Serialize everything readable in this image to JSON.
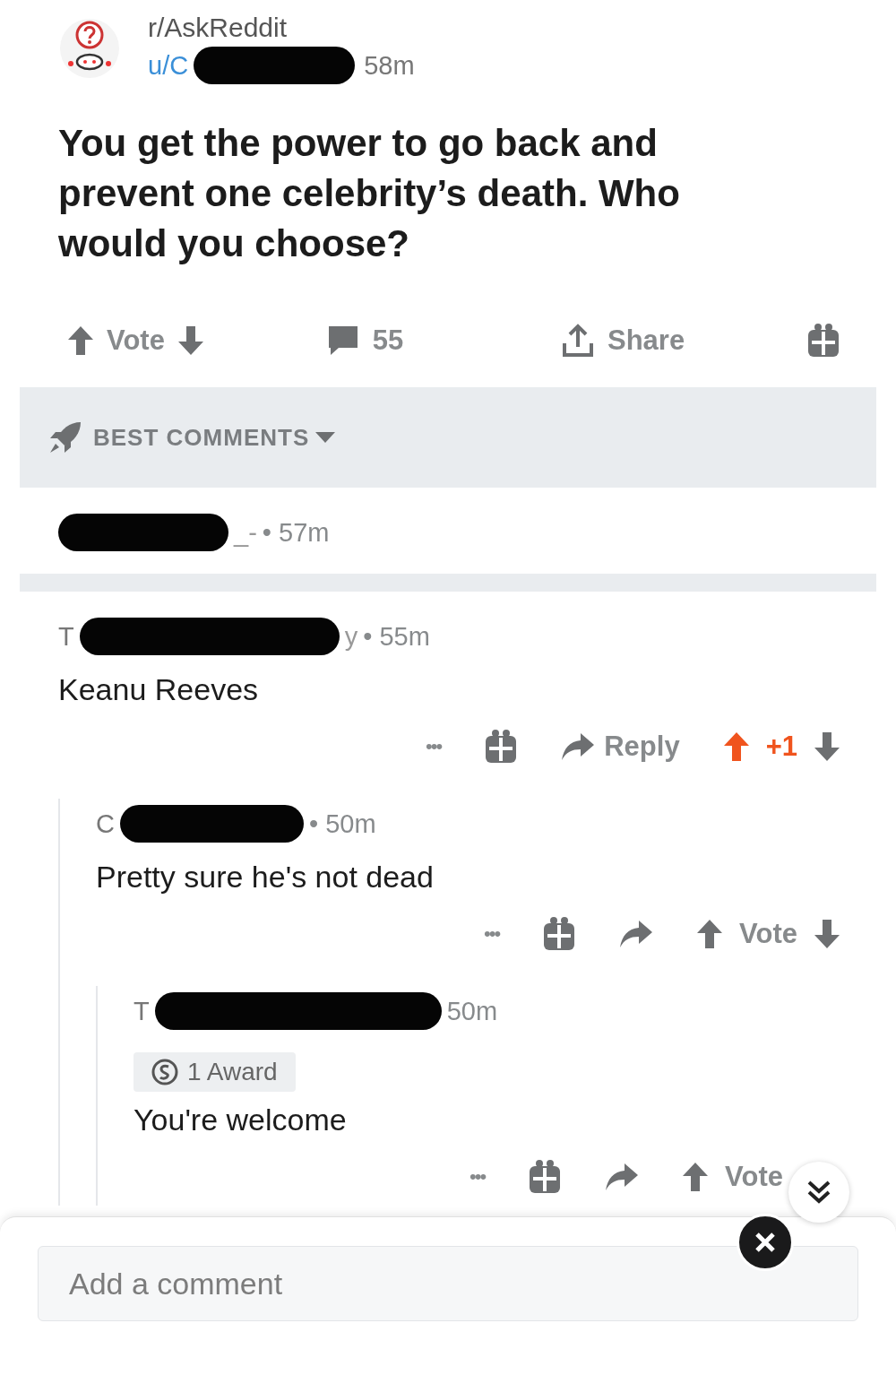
{
  "post": {
    "subreddit": "r/AskReddit",
    "author_start": "u/C",
    "time": "58m",
    "title": "You get the power to go back and prevent one celebrity’s death. Who would you choose?"
  },
  "post_actions": {
    "vote_label": "Vote",
    "comment_count": "55",
    "share_label": "Share"
  },
  "sort": {
    "label": "BEST COMMENTS"
  },
  "comments": [
    {
      "author_end": "_-",
      "time": "• 57m"
    },
    {
      "author_start": "T",
      "author_end": "y",
      "time": "• 55m",
      "body": "Keanu Reeves",
      "actions": {
        "more": "•••",
        "reply_label": "Reply",
        "vote_label": "+1",
        "upvoted": true
      },
      "children": [
        {
          "author_start": "C",
          "time": "• 50m",
          "body": "Pretty sure he's not dead",
          "actions": {
            "more": "•••",
            "vote_label": "Vote",
            "upvoted": false
          },
          "children": [
            {
              "author_start": "T",
              "time": "50m",
              "award": "1 Award",
              "body": "You're welcome",
              "actions": {
                "more": "•••",
                "vote_label": "Vote",
                "upvoted": false,
                "hide_down": true
              }
            }
          ]
        }
      ]
    }
  ],
  "composer": {
    "placeholder": "Add a comment"
  }
}
